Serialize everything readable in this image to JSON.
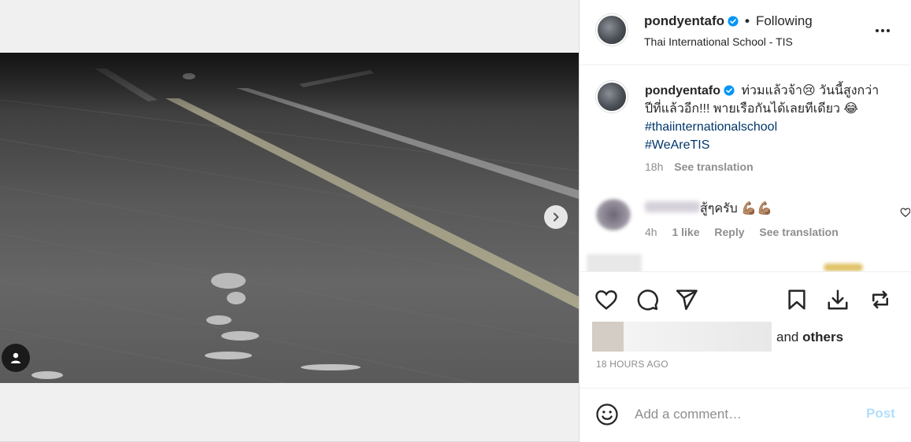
{
  "post": {
    "username": "pondyentafo",
    "follow_status": "Following",
    "location": "Thai International School - TIS",
    "separator": "•",
    "caption_username": "pondyentafo",
    "caption_text": "ท่วมแล้วจ้า😢 วันนี้สูงกว่าปีที่แล้วอีก!!! พายเรือกันได้เลยทีเดียว 😂",
    "hashtag_1": "#thaiinternationalschool",
    "hashtag_2": "#WeAreTIS",
    "caption_age": "18h",
    "see_translation": "See translation"
  },
  "comments": [
    {
      "text": "สู้ๆครับ 💪🏽💪🏽",
      "age": "4h",
      "likes": "1 like",
      "reply": "Reply",
      "see_translation": "See translation"
    }
  ],
  "likes": {
    "and": "and",
    "others": "others"
  },
  "timestamp": "18 HOURS AGO",
  "composer": {
    "placeholder": "Add a comment…",
    "post_label": "Post"
  },
  "carousel": {
    "slide_count": 7,
    "active_index": 0
  },
  "colors": {
    "verified": "#0095f6",
    "post_disabled": "#b2dffc",
    "hashtag": "#00376b",
    "muted": "#8e8e8e"
  },
  "icons": [
    "verified-badge-icon",
    "more-options-icon",
    "chevron-right-icon",
    "user-tag-icon",
    "heart-icon",
    "comment-icon",
    "share-icon",
    "bookmark-icon",
    "download-icon",
    "repost-icon",
    "emoji-icon"
  ]
}
